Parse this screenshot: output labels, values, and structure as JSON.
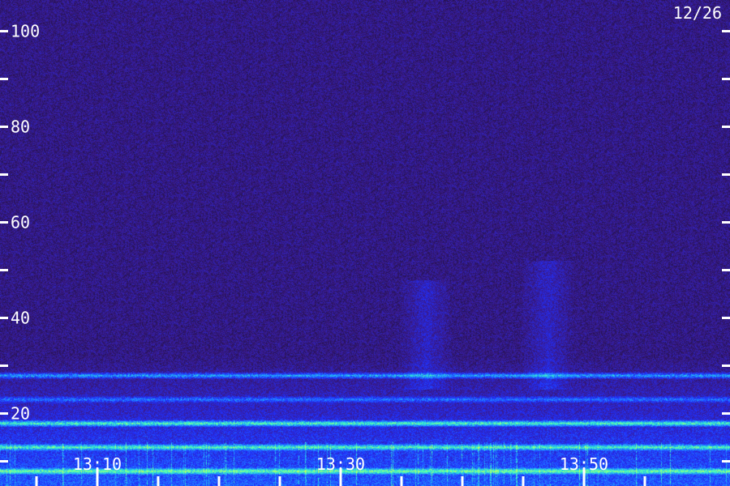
{
  "chart_data": {
    "type": "heatmap",
    "date_label": "12/26",
    "y_ticks": [
      {
        "value": 100,
        "label": "100"
      },
      {
        "value": 90,
        "label": ""
      },
      {
        "value": 80,
        "label": "80"
      },
      {
        "value": 70,
        "label": ""
      },
      {
        "value": 60,
        "label": "60"
      },
      {
        "value": 50,
        "label": ""
      },
      {
        "value": 40,
        "label": "40"
      },
      {
        "value": 30,
        "label": ""
      },
      {
        "value": 20,
        "label": "20"
      },
      {
        "value": 10,
        "label": ""
      }
    ],
    "x_ticks": [
      {
        "time": "13:00",
        "label": "",
        "major": false
      },
      {
        "time": "13:05",
        "label": "",
        "major": false
      },
      {
        "time": "13:10",
        "label": "13:10",
        "major": true
      },
      {
        "time": "13:15",
        "label": "",
        "major": false
      },
      {
        "time": "13:20",
        "label": "",
        "major": false
      },
      {
        "time": "13:25",
        "label": "",
        "major": false
      },
      {
        "time": "13:30",
        "label": "13:30",
        "major": true
      },
      {
        "time": "13:35",
        "label": "",
        "major": false
      },
      {
        "time": "13:40",
        "label": "",
        "major": false
      },
      {
        "time": "13:45",
        "label": "",
        "major": false
      },
      {
        "time": "13:50",
        "label": "13:50",
        "major": true
      },
      {
        "time": "13:55",
        "label": "",
        "major": false
      }
    ],
    "time_range": [
      "13:02",
      "14:02"
    ],
    "y_range": [
      0,
      102
    ],
    "colormap": [
      "#1a0f33",
      "#3a1a8a",
      "#2030ff",
      "#20a0ff",
      "#40ffc0",
      "#c0ff60"
    ],
    "features": [
      {
        "kind": "band",
        "y": 28,
        "strength": 0.8
      },
      {
        "kind": "band",
        "y": 23,
        "strength": 0.5
      },
      {
        "kind": "band",
        "y": 18,
        "strength": 1.0
      },
      {
        "kind": "band",
        "y": 13,
        "strength": 0.9
      },
      {
        "kind": "band",
        "y": 8,
        "strength": 0.9
      },
      {
        "kind": "band",
        "y": 4,
        "strength": 0.6
      },
      {
        "kind": "column_enhancement",
        "time": "13:37",
        "y_from": 25,
        "y_to": 48
      },
      {
        "kind": "column_enhancement",
        "time": "13:47",
        "y_from": 25,
        "y_to": 52
      }
    ]
  }
}
